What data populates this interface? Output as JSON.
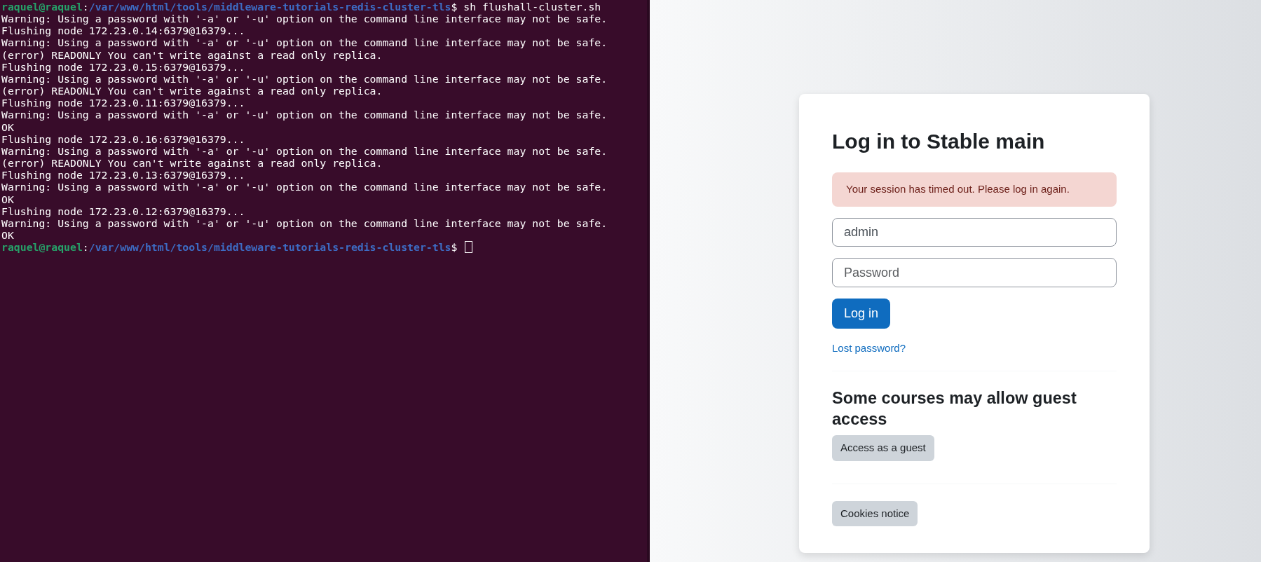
{
  "terminal": {
    "lines": [
      {
        "kind": "prompt",
        "user": "raquel@raquel",
        "path": "/var/www/html/tools/middleware-tutorials-redis-cluster-tls",
        "separator": ":",
        "symbol": "$",
        "command": "sh flushall-cluster.sh"
      },
      {
        "kind": "output",
        "text": "Warning: Using a password with '-a' or '-u' option on the command line interface may not be safe."
      },
      {
        "kind": "output",
        "text": "Flushing node 172.23.0.14:6379@16379..."
      },
      {
        "kind": "output",
        "text": "Warning: Using a password with '-a' or '-u' option on the command line interface may not be safe."
      },
      {
        "kind": "output",
        "text": "(error) READONLY You can't write against a read only replica."
      },
      {
        "kind": "output",
        "text": "Flushing node 172.23.0.15:6379@16379..."
      },
      {
        "kind": "output",
        "text": "Warning: Using a password with '-a' or '-u' option on the command line interface may not be safe."
      },
      {
        "kind": "output",
        "text": "(error) READONLY You can't write against a read only replica."
      },
      {
        "kind": "output",
        "text": "Flushing node 172.23.0.11:6379@16379..."
      },
      {
        "kind": "output",
        "text": "Warning: Using a password with '-a' or '-u' option on the command line interface may not be safe."
      },
      {
        "kind": "output",
        "text": "OK"
      },
      {
        "kind": "output",
        "text": "Flushing node 172.23.0.16:6379@16379..."
      },
      {
        "kind": "output",
        "text": "Warning: Using a password with '-a' or '-u' option on the command line interface may not be safe."
      },
      {
        "kind": "output",
        "text": "(error) READONLY You can't write against a read only replica."
      },
      {
        "kind": "output",
        "text": "Flushing node 172.23.0.13:6379@16379..."
      },
      {
        "kind": "output",
        "text": "Warning: Using a password with '-a' or '-u' option on the command line interface may not be safe."
      },
      {
        "kind": "output",
        "text": "OK"
      },
      {
        "kind": "output",
        "text": "Flushing node 172.23.0.12:6379@16379..."
      },
      {
        "kind": "output",
        "text": "Warning: Using a password with '-a' or '-u' option on the command line interface may not be safe."
      },
      {
        "kind": "output",
        "text": "OK"
      },
      {
        "kind": "prompt",
        "user": "raquel@raquel",
        "path": "/var/www/html/tools/middleware-tutorials-redis-cluster-tls",
        "separator": ":",
        "symbol": "$",
        "cursor": true
      }
    ]
  },
  "login": {
    "title": "Log in to Stable main",
    "alert": "Your session has timed out. Please log in again.",
    "username": {
      "value": "admin"
    },
    "password": {
      "placeholder": "Password"
    },
    "submit": "Log in",
    "lost_password": "Lost password?",
    "guest_heading": "Some courses may allow guest access",
    "guest_button": "Access as a guest",
    "cookies_button": "Cookies notice"
  }
}
